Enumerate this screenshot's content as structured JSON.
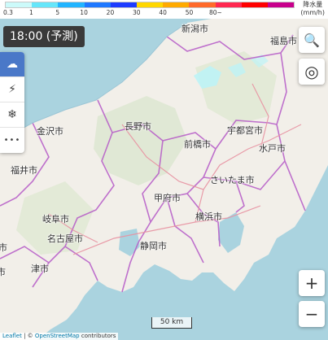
{
  "legend": {
    "colors": [
      "#ccfafa",
      "#66e6fa",
      "#22b4ff",
      "#1f78ff",
      "#1e3cff",
      "#ffd700",
      "#ffaa00",
      "#ff6a2a",
      "#ff2850",
      "#ff0000",
      "#c8008c"
    ],
    "ticks": [
      "0.3",
      "1",
      "5",
      "10",
      "20",
      "30",
      "40",
      "50",
      "80~"
    ],
    "unit_line1": "降水量",
    "unit_line2": "(mm/h)"
  },
  "time_label": "18:00 (予測)",
  "tools": [
    {
      "name": "rain-cloud-icon",
      "glyph": "☁",
      "active": true
    },
    {
      "name": "lightning-icon",
      "glyph": "⚡",
      "active": false
    },
    {
      "name": "snow-icon",
      "glyph": "❄",
      "active": false
    },
    {
      "name": "more-icon",
      "glyph": "•••",
      "active": false
    }
  ],
  "buttons": {
    "search_glyph": "🔍",
    "locate_glyph": "◎",
    "zoom_in": "+",
    "zoom_out": "−"
  },
  "cities": {
    "niigata": "新潟市",
    "fukushima": "福島市",
    "kanazawa": "金沢市",
    "nagano": "長野市",
    "utsunomiya": "宇都宮市",
    "maebashi": "前橋市",
    "mito": "水戸市",
    "fukui": "福井市",
    "saitama": "さいたま市",
    "kofu": "甲府市",
    "gifu": "岐阜市",
    "yokohama": "横浜市",
    "nagoya": "名古屋市",
    "shizuoka": "静岡市",
    "tsu": "津市",
    "partial_left_1": "市",
    "partial_left_2": "市"
  },
  "scale_label": "50 km",
  "attribution": {
    "leaflet": "Leaflet",
    "separator": " | © ",
    "osm": "OpenStreetMap",
    "contributors": " contributors"
  }
}
